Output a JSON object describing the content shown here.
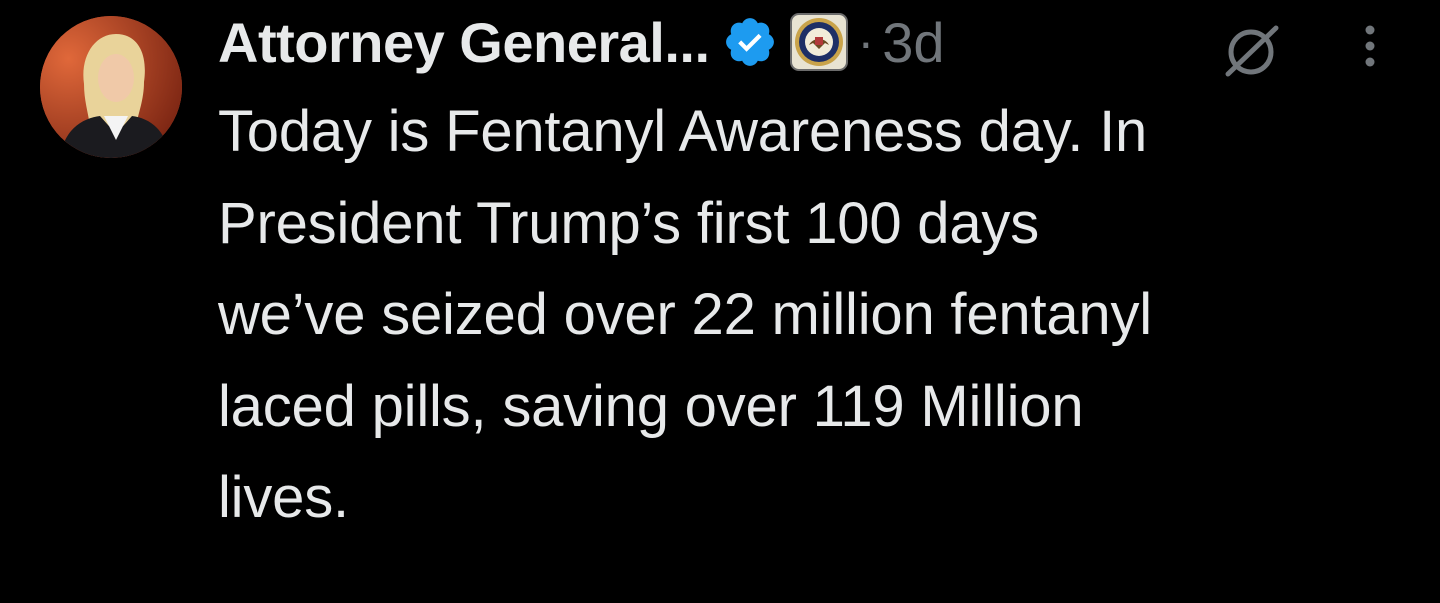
{
  "tweet": {
    "author": {
      "display_name": "Attorney General...",
      "avatar_icon": "avatar-photo",
      "verified_icon": "verified-badge-icon",
      "affiliation_icon": "doj-seal-icon"
    },
    "separator": "·",
    "timestamp": "3d",
    "grok_icon": "grok-icon",
    "more_icon": "more-vertical-icon",
    "text_lines": [
      "Today is Fentanyl Awareness day. In",
      "President Trump’s first 100 days",
      "we’ve seized over 22 million fentanyl",
      "laced pills, saving over 119 Million",
      "lives."
    ]
  },
  "colors": {
    "background": "#000000",
    "primary_text": "#e7e9ea",
    "secondary_text": "#71767b",
    "verified_blue": "#1d9bf0"
  }
}
